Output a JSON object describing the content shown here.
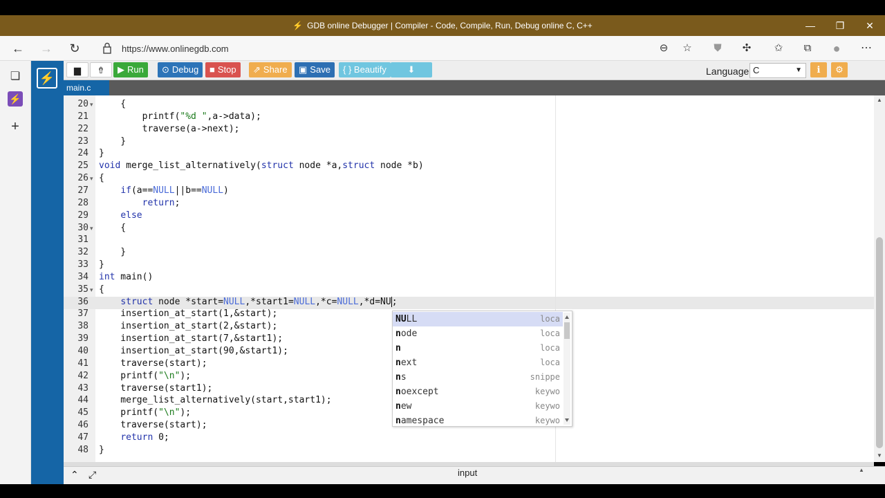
{
  "window": {
    "title": "GDB online Debugger | Compiler - Code, Compile, Run, Debug online C, C++",
    "bolt_icon": "lightning-bolt-icon"
  },
  "browser": {
    "url": "https://www.onlinegdb.com"
  },
  "toolbar": {
    "run": "Run",
    "debug": "Debug",
    "stop": "Stop",
    "share": "Share",
    "save": "Save",
    "beautify": "{ } Beautify",
    "language_label": "Language",
    "language_value": "C",
    "colors": {
      "run": "#3aa93a",
      "debug": "#2d74b8",
      "stop": "#d9534f",
      "share": "#f0ad4e",
      "save": "#2d6fb3",
      "beautify": "#5bc0de",
      "download": "#5bc0de",
      "info": "#f0ad4e",
      "settings": "#f0ad4e"
    }
  },
  "tab": {
    "name": "main.c"
  },
  "editor": {
    "lines": [
      {
        "n": "20",
        "code": "    {",
        "fold": true
      },
      {
        "n": "21",
        "code": "        printf(\"%d \",a->data);"
      },
      {
        "n": "22",
        "code": "        traverse(a->next);"
      },
      {
        "n": "23",
        "code": "    }"
      },
      {
        "n": "24",
        "code": "}"
      },
      {
        "n": "25",
        "code": "void merge_list_alternatively(struct node *a,struct node *b)"
      },
      {
        "n": "26",
        "code": "{",
        "fold": true
      },
      {
        "n": "27",
        "code": "    if(a==NULL||b==NULL)"
      },
      {
        "n": "28",
        "code": "        return;"
      },
      {
        "n": "29",
        "code": "    else"
      },
      {
        "n": "30",
        "code": "    {",
        "fold": true
      },
      {
        "n": "31",
        "code": ""
      },
      {
        "n": "32",
        "code": "    }"
      },
      {
        "n": "33",
        "code": "}"
      },
      {
        "n": "34",
        "code": "int main()"
      },
      {
        "n": "35",
        "code": "{",
        "fold": true
      },
      {
        "n": "36",
        "code": "    struct node *start=NULL,*start1=NULL,*c=NULL,*d=NU;"
      },
      {
        "n": "37",
        "code": "    insertion_at_start(1,&start);"
      },
      {
        "n": "38",
        "code": "    insertion_at_start(2,&start);"
      },
      {
        "n": "39",
        "code": "    insertion_at_start(7,&start1);"
      },
      {
        "n": "40",
        "code": "    insertion_at_start(90,&start1);"
      },
      {
        "n": "41",
        "code": "    traverse(start);"
      },
      {
        "n": "42",
        "code": "    printf(\"\\n\");"
      },
      {
        "n": "43",
        "code": "    traverse(start1);"
      },
      {
        "n": "44",
        "code": "    merge_list_alternatively(start,start1);"
      },
      {
        "n": "45",
        "code": "    printf(\"\\n\");"
      },
      {
        "n": "46",
        "code": "    traverse(start);"
      },
      {
        "n": "47",
        "code": "    return 0;"
      },
      {
        "n": "48",
        "code": "}"
      }
    ]
  },
  "autocomplete": {
    "items": [
      {
        "word": "NULL",
        "meta": "loca"
      },
      {
        "word": "node",
        "meta": "loca"
      },
      {
        "word": "n",
        "meta": "loca"
      },
      {
        "word": "next",
        "meta": "loca"
      },
      {
        "word": "ns",
        "meta": "snippe"
      },
      {
        "word": "noexcept",
        "meta": "keywo"
      },
      {
        "word": "new",
        "meta": "keywo"
      },
      {
        "word": "namespace",
        "meta": "keywo"
      }
    ],
    "selected_color": "#d6dcf5"
  },
  "bottom": {
    "label": "input"
  }
}
